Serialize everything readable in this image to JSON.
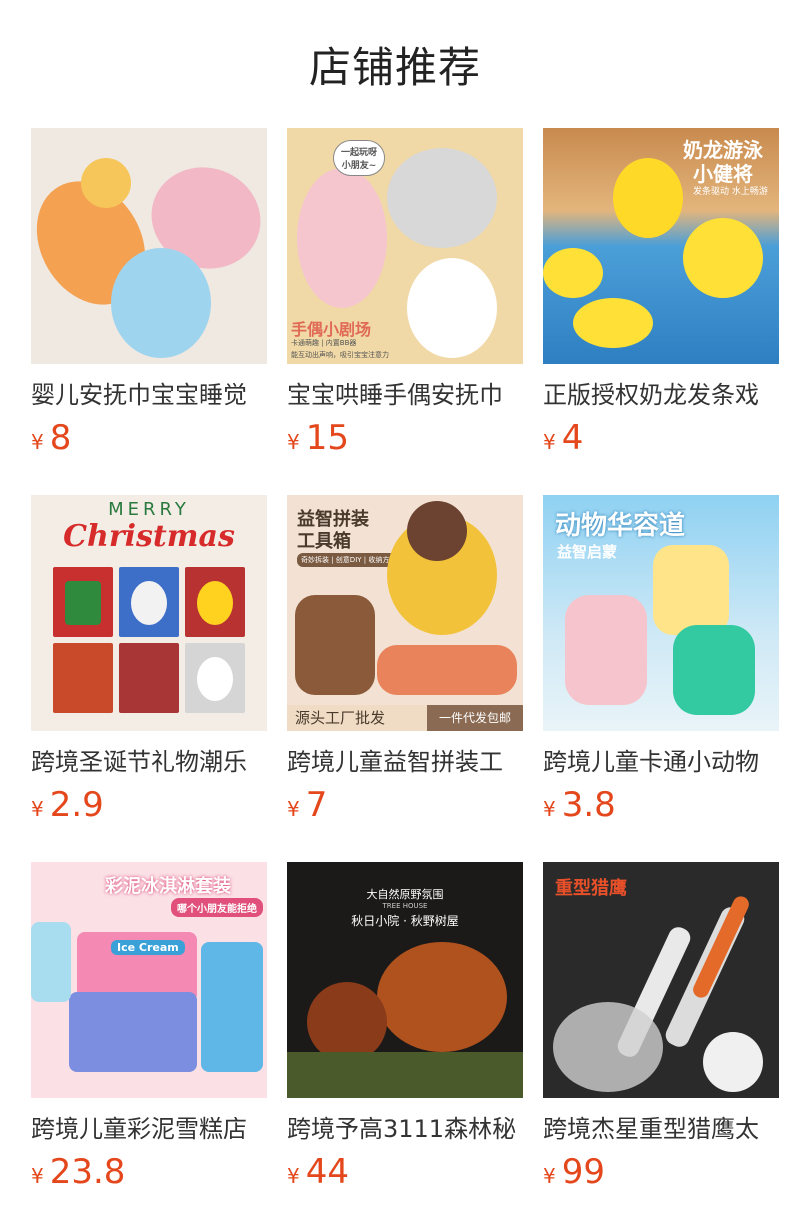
{
  "header": {
    "title": "店铺推荐"
  },
  "products": [
    {
      "name": "婴儿安抚巾宝宝睡觉",
      "currency": "¥",
      "price": "8",
      "image_text": []
    },
    {
      "name": "宝宝哄睡手偶安抚巾",
      "currency": "¥",
      "price": "15",
      "image_text": [
        "一起玩呀 小朋友~",
        "手偶小剧场",
        "卡通萌趣 | 内置BB器",
        "能互动出声响，吸引宝宝注意力"
      ]
    },
    {
      "name": "正版授权奶龙发条戏",
      "currency": "¥",
      "price": "4",
      "image_text": [
        "奶龙游泳",
        "小健将",
        "发条驱动 水上畅游"
      ]
    },
    {
      "name": "跨境圣诞节礼物潮乐",
      "currency": "¥",
      "price": "2.9",
      "image_text": [
        "MERRY",
        "Christmas"
      ]
    },
    {
      "name": "跨境儿童益智拼装工",
      "currency": "¥",
      "price": "7",
      "image_text": [
        "益智拼装",
        "工具箱",
        "奇妙拆装 | 创意DIY | 收纳方便",
        "源头工厂批发",
        "一件代发包邮"
      ]
    },
    {
      "name": "跨境儿童卡通小动物",
      "currency": "¥",
      "price": "3.8",
      "image_text": [
        "动物华容道",
        "益智启蒙"
      ]
    },
    {
      "name": "跨境儿童彩泥雪糕店",
      "currency": "¥",
      "price": "23.8",
      "image_text": [
        "彩泥冰淇淋套装",
        "哪个小朋友能拒绝",
        "Ice Cream"
      ]
    },
    {
      "name": "跨境予高3111森林秘",
      "currency": "¥",
      "price": "44",
      "image_text": [
        "大自然原野氛围",
        "TREE HOUSE",
        "秋日小院 · 秋野树屋"
      ]
    },
    {
      "name": "跨境杰星重型猎鹰太",
      "currency": "¥",
      "price": "99",
      "image_text": [
        "重型猎鹰"
      ]
    }
  ],
  "colors": {
    "price": "#e4471c",
    "title": "#222222",
    "name": "#333333"
  }
}
